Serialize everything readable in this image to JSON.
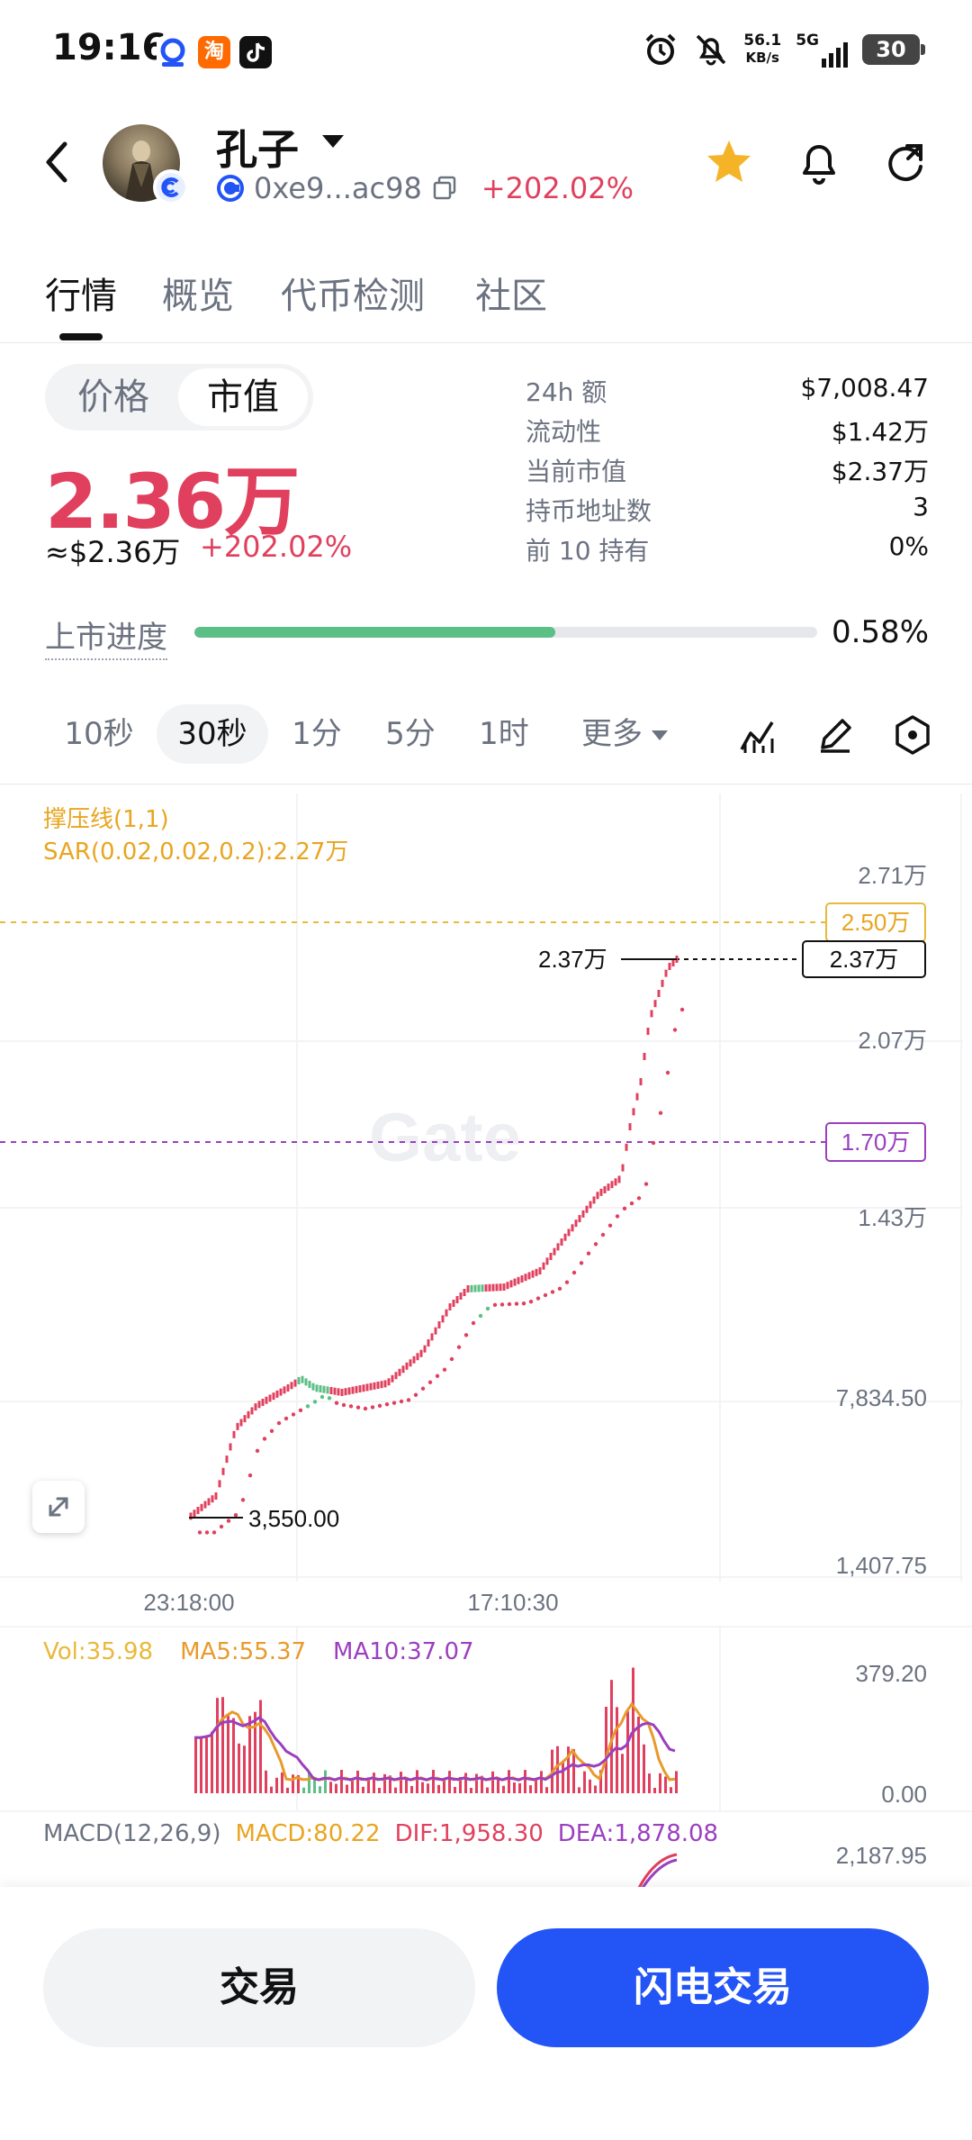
{
  "status_bar": {
    "time": "19:16",
    "apps": [
      "gate-app-icon",
      "taobao-app-icon",
      "tiktok-app-icon"
    ],
    "taobao_label": "淘",
    "net_speed_value": "56.1",
    "net_speed_unit": "KB/s",
    "network": "5G",
    "battery": "30"
  },
  "header": {
    "token_name": "孔子",
    "address": "0xe9...ac98",
    "change": "+202.02%"
  },
  "tabs": [
    {
      "label": "行情"
    },
    {
      "label": "概览"
    },
    {
      "label": "代币检测"
    },
    {
      "label": "社区"
    }
  ],
  "price": {
    "toggle": [
      "价格",
      "市值"
    ],
    "big_value": "2.36万",
    "usd_value": "≈$2.36万",
    "change": "+202.02%"
  },
  "stats": [
    {
      "label": "24h 额",
      "value": "$7,008.47"
    },
    {
      "label": "流动性",
      "value": "$1.42万"
    },
    {
      "label": "当前市值",
      "value": "$2.37万"
    },
    {
      "label": "持币地址数",
      "value": "3"
    },
    {
      "label": "前 10 持有",
      "value": "0%"
    }
  ],
  "listing_progress": {
    "label": "上市进度",
    "value": "0.58%",
    "fill_fraction": 0.58
  },
  "intervals": {
    "items": [
      "10秒",
      "30秒",
      "1分",
      "5分",
      "1时"
    ],
    "more": "更多"
  },
  "chart": {
    "indicator_1": "撑压线(1,1)",
    "indicator_2": "SAR(0.02,0.02,0.2):2.27万",
    "y_ticks": [
      "2.71万",
      "2.07万",
      "1.43万",
      "7,834.50",
      "1,407.75"
    ],
    "resistance_label": "2.50万",
    "support_label": "1.70万",
    "current_label": "2.37万",
    "last_price_tag": "2.37万",
    "low_marker": "3,550.00",
    "x_ticks": [
      "23:18:00",
      "17:10:30"
    ],
    "watermark": "Gate",
    "colors": {
      "up": "#e0405e",
      "down": "#5cbf86",
      "resistance": "#e8b93a",
      "support": "#9b3fc0"
    }
  },
  "volume": {
    "vol": "Vol:35.98",
    "ma5": "MA5:55.37",
    "ma10": "MA10:37.07",
    "y_max": "379.20",
    "y_min": "0.00"
  },
  "macd": {
    "label": "MACD(12,26,9)",
    "macd": "MACD:80.22",
    "dif": "DIF:1,958.30",
    "dea": "DEA:1,878.08",
    "y_max": "2,187.95"
  },
  "buttons": {
    "trade": "交易",
    "flash_trade": "闪电交易"
  }
}
